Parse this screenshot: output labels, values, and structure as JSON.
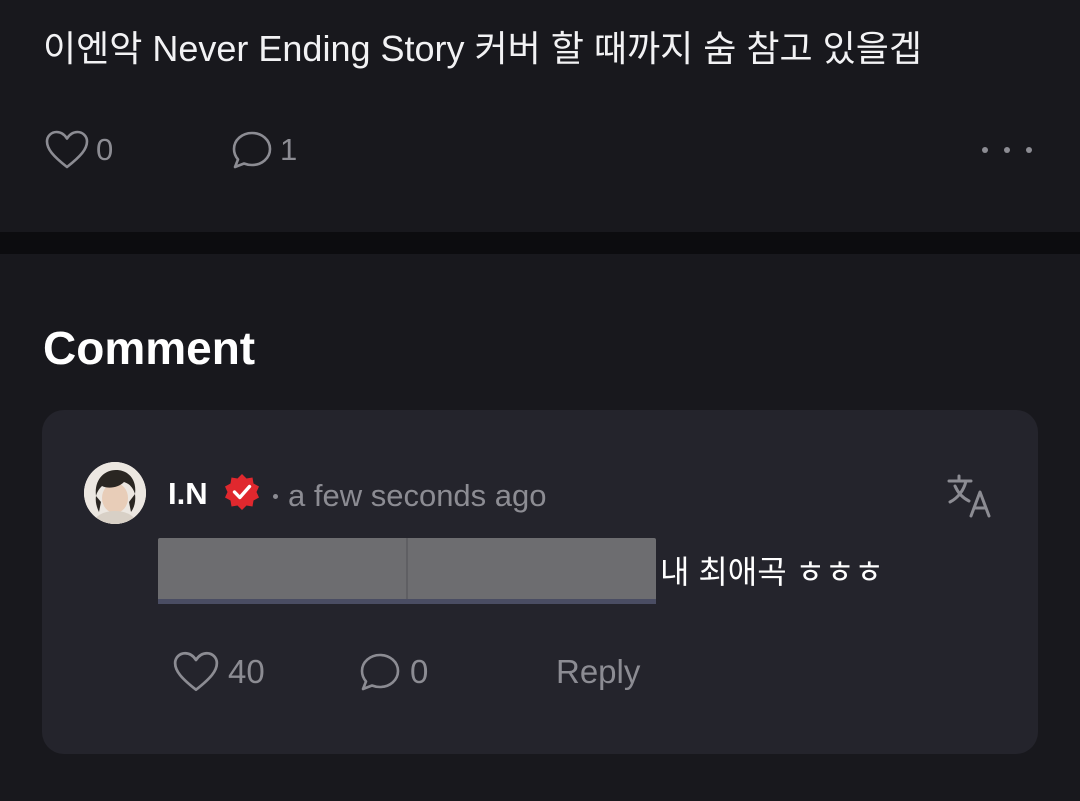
{
  "post": {
    "title": "이엔악 Never Ending Story 커버 할 때까지 숨 참고 있을겝",
    "like_count": "0",
    "comment_count": "1"
  },
  "comments_section": {
    "heading": "Comment",
    "comments": [
      {
        "author": "I.N",
        "timestamp": "a few seconds ago",
        "text": "내 최애곡 ㅎㅎㅎ",
        "like_count": "40",
        "reply_count": "0",
        "reply_label": "Reply"
      }
    ]
  },
  "icons": {
    "like": "heart-outline-icon",
    "comment": "speech-bubble-icon",
    "more": "more-horizontal-icon",
    "verified": "verified-badge-icon",
    "translate": "translate-icon"
  },
  "colors": {
    "background": "#18181d",
    "card": "#24242c",
    "divider": "#0c0c0f",
    "muted_text": "#8c8c93",
    "verified_badge": "#e0282e"
  }
}
